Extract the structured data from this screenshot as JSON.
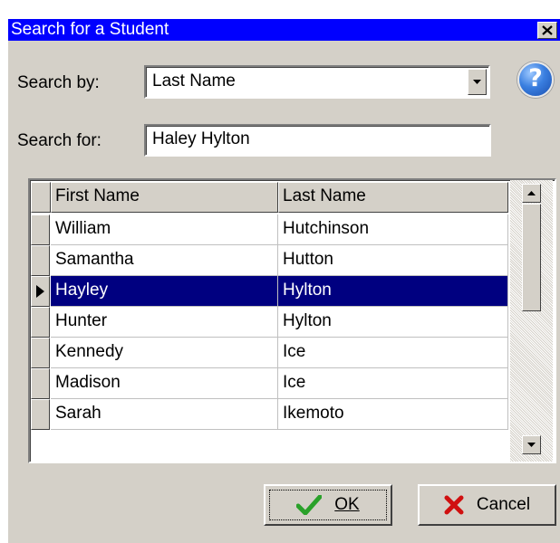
{
  "window": {
    "title": "Search for a Student",
    "close_glyph": "✕"
  },
  "search_by": {
    "label": "Search by:",
    "value": "Last Name"
  },
  "help": {
    "glyph": "?",
    "icon": "help-icon"
  },
  "search_for": {
    "label": "Search for:",
    "value": "Haley Hylton"
  },
  "grid": {
    "columns": [
      "First Name",
      "Last Name"
    ],
    "rows": [
      {
        "first": "William",
        "last": "Hutchinson",
        "selected": false
      },
      {
        "first": "Samantha",
        "last": "Hutton",
        "selected": false
      },
      {
        "first": "Hayley",
        "last": "Hylton",
        "selected": true
      },
      {
        "first": "Hunter",
        "last": "Hylton",
        "selected": false
      },
      {
        "first": "Kennedy",
        "last": "Ice",
        "selected": false
      },
      {
        "first": "Madison",
        "last": "Ice",
        "selected": false
      },
      {
        "first": "Sarah",
        "last": "Ikemoto",
        "selected": false
      }
    ]
  },
  "buttons": {
    "ok_label": "OK",
    "cancel_label": "Cancel"
  },
  "colors": {
    "titlebar": "#0000ff",
    "selection": "#000080",
    "face": "#d4d0c8",
    "ok_check": "#2aa12a",
    "cancel_x": "#d01010"
  }
}
